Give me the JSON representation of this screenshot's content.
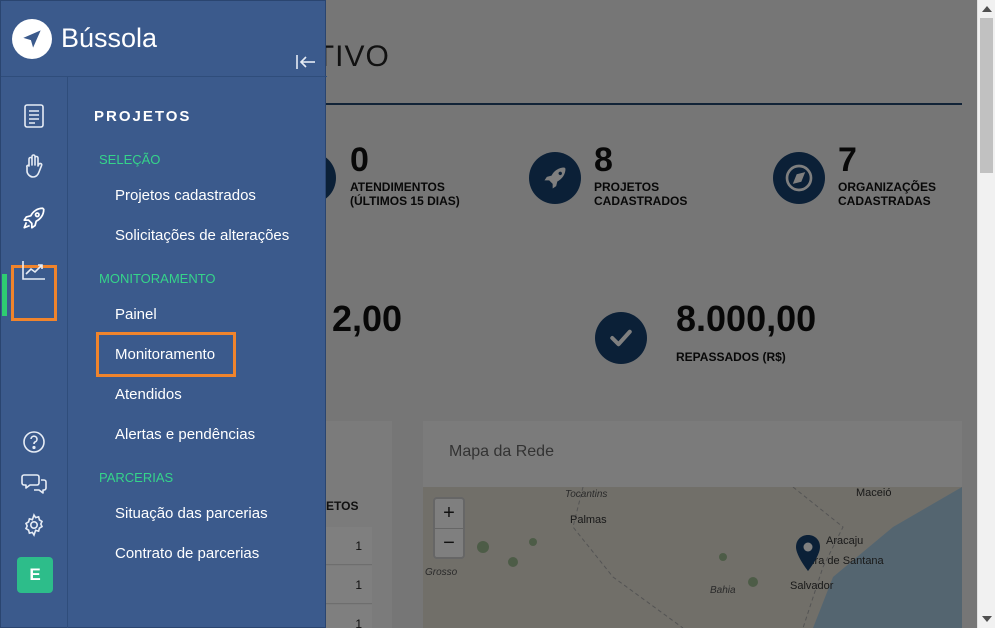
{
  "app": {
    "brand": "Bússola",
    "avatar_letter": "E",
    "accent_orange": "#f0842c",
    "accent_green": "#2ecc71",
    "sidebar_color": "#3b5a8c"
  },
  "rail": {
    "items": [
      {
        "icon": "document-icon"
      },
      {
        "icon": "hand-icon"
      },
      {
        "icon": "rocket-icon",
        "active": true
      },
      {
        "icon": "chart-icon"
      }
    ],
    "bottom": [
      {
        "icon": "help-icon"
      },
      {
        "icon": "chat-icon"
      },
      {
        "icon": "gear-icon"
      }
    ]
  },
  "menu": {
    "title": "PROJETOS",
    "sections": [
      {
        "label": "SELEÇÃO",
        "items": [
          "Projetos cadastrados",
          "Solicitações de alterações"
        ]
      },
      {
        "label": "MONITORAMENTO",
        "items": [
          "Painel",
          "Monitoramento",
          "Atendidos",
          "Alertas e pendências"
        ]
      },
      {
        "label": "PARCERIAS",
        "items": [
          "Situação das parcerias",
          "Contrato de parcerias"
        ]
      }
    ]
  },
  "dashboard": {
    "title_fragment": "ATIVO",
    "stats": [
      {
        "value": "0",
        "label": "ATENDIMENTOS (ÚLTIMOS 15 DIAS)"
      },
      {
        "value": "8",
        "label": "PROJETOS CADASTRADOS"
      },
      {
        "value": "7",
        "label": "ORGANIZAÇÕES CADASTRADAS"
      }
    ],
    "amount_partial": "2,00",
    "amount": "8.000,00",
    "amount_label": "REPASSADOS (R$)",
    "map_title": "Mapa da Rede",
    "map_labels": {
      "tocantins": "Tocantins",
      "palmas": "Palmas",
      "maceio": "Maceió",
      "aracaju": "Aracaju",
      "feira": "eira de Santana",
      "salvador": "Salvador",
      "bahia": "Bahia",
      "grosso": "Grosso"
    },
    "zoom_in": "+",
    "zoom_out": "−",
    "table_header_fragment": "ETOS",
    "table_values": [
      "1",
      "1",
      "1"
    ]
  }
}
